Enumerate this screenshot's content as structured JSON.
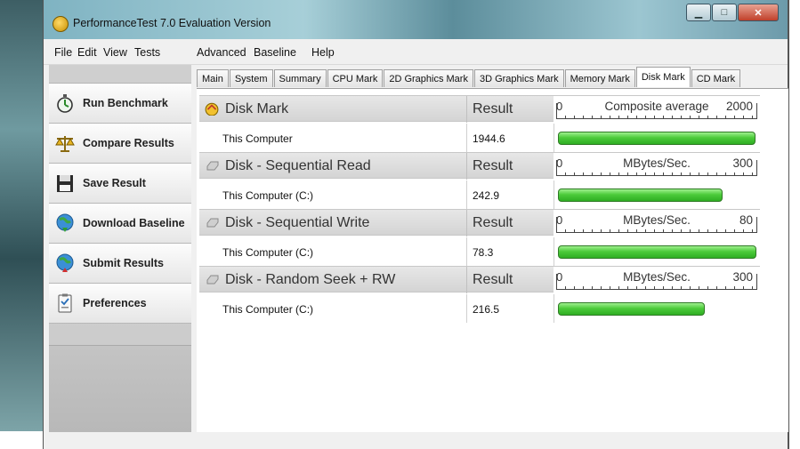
{
  "window": {
    "title": "PerformanceTest 7.0 Evaluation Version"
  },
  "menu": [
    "File",
    "Edit",
    "View",
    "Tests",
    "Advanced",
    "Baseline",
    "Help"
  ],
  "sidebar": {
    "items": [
      {
        "label": "Run Benchmark",
        "icon": "stopwatch-icon"
      },
      {
        "label": "Compare Results",
        "icon": "scales-icon"
      },
      {
        "label": "Save Result",
        "icon": "floppy-disk-icon"
      },
      {
        "label": "Download Baseline",
        "icon": "globe-download-icon"
      },
      {
        "label": "Submit Results",
        "icon": "globe-upload-icon"
      },
      {
        "label": "Preferences",
        "icon": "clipboard-icon"
      }
    ]
  },
  "tabs": [
    {
      "label": "Main"
    },
    {
      "label": "System"
    },
    {
      "label": "Summary"
    },
    {
      "label": "CPU Mark"
    },
    {
      "label": "2D Graphics Mark"
    },
    {
      "label": "3D Graphics Mark"
    },
    {
      "label": "Memory Mark"
    },
    {
      "label": "Disk Mark",
      "active": true
    },
    {
      "label": "CD Mark"
    }
  ],
  "results": [
    {
      "title": "Disk Mark",
      "result_header": "Result",
      "scale_min": "0",
      "scale_unit": "Composite average",
      "scale_max": "2000",
      "row_label": "This Computer",
      "value_text": "1944.6",
      "value": 1944.6,
      "max": 2000
    },
    {
      "title": "Disk - Sequential Read",
      "result_header": "Result",
      "scale_min": "0",
      "scale_unit": "MBytes/Sec.",
      "scale_max": "300",
      "row_label": "This Computer (C:)",
      "value_text": "242.9",
      "value": 242.9,
      "max": 300
    },
    {
      "title": "Disk - Sequential Write",
      "result_header": "Result",
      "scale_min": "0",
      "scale_unit": "MBytes/Sec.",
      "scale_max": "80",
      "row_label": "This Computer (C:)",
      "value_text": "78.3",
      "value": 78.3,
      "max": 80
    },
    {
      "title": "Disk - Random Seek + RW",
      "result_header": "Result",
      "scale_min": "0",
      "scale_unit": "MBytes/Sec.",
      "scale_max": "300",
      "row_label": "This Computer (C:)",
      "value_text": "216.5",
      "value": 216.5,
      "max": 300
    }
  ]
}
